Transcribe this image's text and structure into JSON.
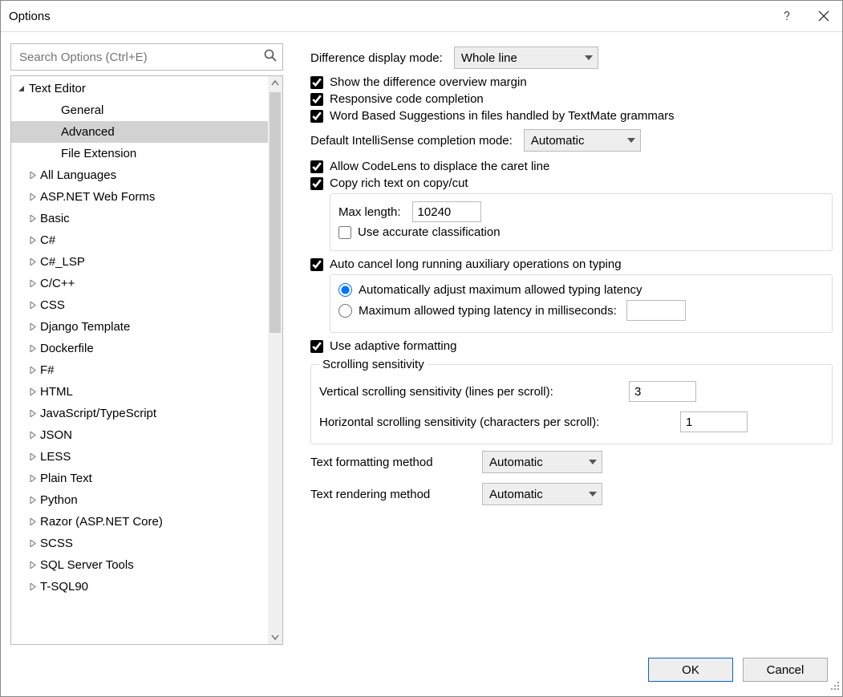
{
  "window": {
    "title": "Options"
  },
  "search": {
    "placeholder": "Search Options (Ctrl+E)"
  },
  "tree": {
    "root": "Text Editor",
    "items": [
      {
        "label": "General",
        "depth": 2
      },
      {
        "label": "Advanced",
        "depth": 2,
        "selected": true
      },
      {
        "label": "File Extension",
        "depth": 2
      },
      {
        "label": "All Languages",
        "depth": 1,
        "dis": true
      },
      {
        "label": "ASP.NET Web Forms",
        "depth": 1,
        "dis": true
      },
      {
        "label": "Basic",
        "depth": 1,
        "dis": true
      },
      {
        "label": "C#",
        "depth": 1,
        "dis": true
      },
      {
        "label": "C#_LSP",
        "depth": 1,
        "dis": true
      },
      {
        "label": "C/C++",
        "depth": 1,
        "dis": true
      },
      {
        "label": "CSS",
        "depth": 1,
        "dis": true
      },
      {
        "label": "Django Template",
        "depth": 1,
        "dis": true
      },
      {
        "label": "Dockerfile",
        "depth": 1,
        "dis": true
      },
      {
        "label": "F#",
        "depth": 1,
        "dis": true
      },
      {
        "label": "HTML",
        "depth": 1,
        "dis": true
      },
      {
        "label": "JavaScript/TypeScript",
        "depth": 1,
        "dis": true
      },
      {
        "label": "JSON",
        "depth": 1,
        "dis": true
      },
      {
        "label": "LESS",
        "depth": 1,
        "dis": true
      },
      {
        "label": "Plain Text",
        "depth": 1,
        "dis": true
      },
      {
        "label": "Python",
        "depth": 1,
        "dis": true
      },
      {
        "label": "Razor (ASP.NET Core)",
        "depth": 1,
        "dis": true
      },
      {
        "label": "SCSS",
        "depth": 1,
        "dis": true
      },
      {
        "label": "SQL Server Tools",
        "depth": 1,
        "dis": true
      },
      {
        "label": "T-SQL90",
        "depth": 1,
        "dis": true
      }
    ]
  },
  "settings": {
    "diff_label": "Difference display mode:",
    "diff_value": "Whole line",
    "show_diff_margin": "Show the difference overview margin",
    "responsive_completion": "Responsive code completion",
    "word_suggestions": "Word Based Suggestions in files handled by TextMate grammars",
    "default_intellisense_label": "Default IntelliSense completion mode:",
    "default_intellisense_value": "Automatic",
    "allow_codelens": "Allow CodeLens to displace the caret line",
    "copy_rich": "Copy rich text on copy/cut",
    "max_length_label": "Max length:",
    "max_length_value": "10240",
    "use_accurate": "Use accurate classification",
    "auto_cancel": "Auto cancel long running auxiliary operations on typing",
    "radio_auto": "Automatically adjust maximum allowed typing latency",
    "radio_max": "Maximum allowed typing latency in milliseconds:",
    "radio_max_value": "",
    "use_adaptive": "Use adaptive formatting",
    "scroll_legend": "Scrolling sensitivity",
    "vscroll_label": "Vertical scrolling sensitivity (lines per scroll):",
    "vscroll_value": "3",
    "hscroll_label": "Horizontal scrolling sensitivity (characters per scroll):",
    "hscroll_value": "1",
    "fmt_label": "Text formatting method",
    "fmt_value": "Automatic",
    "render_label": "Text rendering method",
    "render_value": "Automatic"
  },
  "footer": {
    "ok": "OK",
    "cancel": "Cancel"
  }
}
